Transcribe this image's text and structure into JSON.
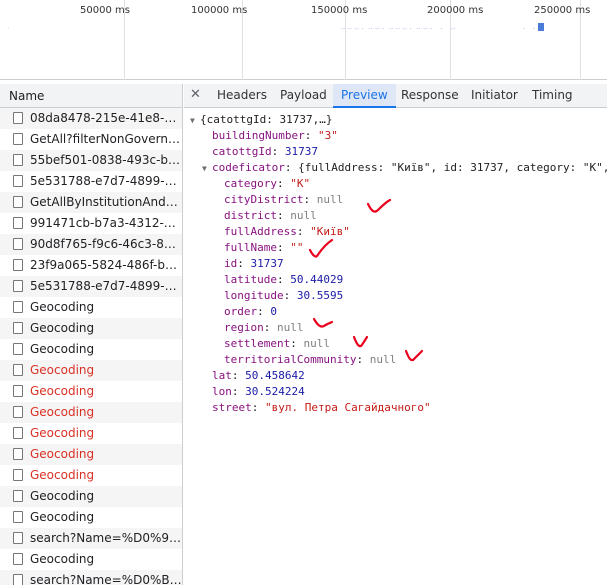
{
  "timeline": {
    "ticks": [
      "50000 ms",
      "100000 ms",
      "150000 ms",
      "200000 ms",
      "250000 ms"
    ]
  },
  "name_column": {
    "header": "Name",
    "rows": [
      {
        "text": "08da8478-215e-41e8-881...",
        "error": false,
        "icon": "document-icon"
      },
      {
        "text": "GetAll?filterNonGovernm...",
        "error": false,
        "icon": "document-icon"
      },
      {
        "text": "55bef501-0838-493c-b5f...",
        "error": false,
        "icon": "document-icon"
      },
      {
        "text": "5e531788-e7d7-4899-80c...",
        "error": false,
        "icon": "document-icon"
      },
      {
        "text": "GetAllByInstitutionAndLev...",
        "error": false,
        "icon": "document-icon"
      },
      {
        "text": "991471cb-b7a3-4312-bb...",
        "error": false,
        "icon": "document-icon"
      },
      {
        "text": "90d8f765-f9c6-46c3-8b24...",
        "error": false,
        "icon": "document-icon"
      },
      {
        "text": "23f9a065-5824-486f-bae3...",
        "error": false,
        "icon": "document-icon"
      },
      {
        "text": "5e531788-e7d7-4899-80c...",
        "error": false,
        "icon": "document-icon"
      },
      {
        "text": "Geocoding",
        "error": false,
        "icon": "document-icon"
      },
      {
        "text": "Geocoding",
        "error": false,
        "icon": "document-icon"
      },
      {
        "text": "Geocoding",
        "error": false,
        "icon": "document-icon"
      },
      {
        "text": "Geocoding",
        "error": true,
        "icon": "document-icon"
      },
      {
        "text": "Geocoding",
        "error": true,
        "icon": "document-icon"
      },
      {
        "text": "Geocoding",
        "error": true,
        "icon": "document-icon"
      },
      {
        "text": "Geocoding",
        "error": true,
        "icon": "document-icon"
      },
      {
        "text": "Geocoding",
        "error": true,
        "icon": "document-icon"
      },
      {
        "text": "Geocoding",
        "error": true,
        "icon": "document-icon"
      },
      {
        "text": "Geocoding",
        "error": false,
        "icon": "document-icon"
      },
      {
        "text": "Geocoding",
        "error": false,
        "icon": "document-icon"
      },
      {
        "text": "search?Name=%D0%9B%...",
        "error": false,
        "icon": "document-icon"
      },
      {
        "text": "Geocoding",
        "error": false,
        "icon": "document-icon"
      },
      {
        "text": "search?Name=%D0%BA...",
        "error": false,
        "icon": "document-icon"
      }
    ]
  },
  "detail": {
    "close_icon": "close-icon",
    "tabs": [
      "Headers",
      "Payload",
      "Preview",
      "Response",
      "Initiator",
      "Timing"
    ],
    "active_tab": "Preview"
  },
  "preview": {
    "lines": [
      {
        "indent": 0,
        "toggle": "down",
        "parts": [
          {
            "c": "plain",
            "t": "{catottgId: 31737,…}"
          }
        ]
      },
      {
        "indent": 1,
        "parts": [
          {
            "c": "key",
            "t": "buildingNumber"
          },
          {
            "c": "plain",
            "t": ": "
          },
          {
            "c": "str",
            "t": "\"3\""
          }
        ]
      },
      {
        "indent": 1,
        "parts": [
          {
            "c": "key",
            "t": "catottgId"
          },
          {
            "c": "plain",
            "t": ": "
          },
          {
            "c": "num",
            "t": "31737"
          }
        ]
      },
      {
        "indent": 1,
        "toggle": "down",
        "parts": [
          {
            "c": "key",
            "t": "codeficator"
          },
          {
            "c": "plain",
            "t": ": {fullAddress: \"Київ\", id: 31737, category: \"K\","
          }
        ]
      },
      {
        "indent": 2,
        "parts": [
          {
            "c": "key",
            "t": "category"
          },
          {
            "c": "plain",
            "t": ": "
          },
          {
            "c": "str",
            "t": "\"K\""
          }
        ]
      },
      {
        "indent": 2,
        "parts": [
          {
            "c": "key",
            "t": "cityDistrict"
          },
          {
            "c": "plain",
            "t": ": "
          },
          {
            "c": "nul",
            "t": "null"
          }
        ]
      },
      {
        "indent": 2,
        "parts": [
          {
            "c": "key",
            "t": "district"
          },
          {
            "c": "plain",
            "t": ": "
          },
          {
            "c": "nul",
            "t": "null"
          }
        ]
      },
      {
        "indent": 2,
        "parts": [
          {
            "c": "key",
            "t": "fullAddress"
          },
          {
            "c": "plain",
            "t": ": "
          },
          {
            "c": "str",
            "t": "\"Київ\""
          }
        ]
      },
      {
        "indent": 2,
        "parts": [
          {
            "c": "key",
            "t": "fullName"
          },
          {
            "c": "plain",
            "t": ": "
          },
          {
            "c": "str",
            "t": "\"\""
          }
        ]
      },
      {
        "indent": 2,
        "parts": [
          {
            "c": "key",
            "t": "id"
          },
          {
            "c": "plain",
            "t": ": "
          },
          {
            "c": "num",
            "t": "31737"
          }
        ]
      },
      {
        "indent": 2,
        "parts": [
          {
            "c": "key",
            "t": "latitude"
          },
          {
            "c": "plain",
            "t": ": "
          },
          {
            "c": "num",
            "t": "50.44029"
          }
        ]
      },
      {
        "indent": 2,
        "parts": [
          {
            "c": "key",
            "t": "longitude"
          },
          {
            "c": "plain",
            "t": ": "
          },
          {
            "c": "num",
            "t": "30.5595"
          }
        ]
      },
      {
        "indent": 2,
        "parts": [
          {
            "c": "key",
            "t": "order"
          },
          {
            "c": "plain",
            "t": ": "
          },
          {
            "c": "num",
            "t": "0"
          }
        ]
      },
      {
        "indent": 2,
        "parts": [
          {
            "c": "key",
            "t": "region"
          },
          {
            "c": "plain",
            "t": ": "
          },
          {
            "c": "nul",
            "t": "null"
          }
        ]
      },
      {
        "indent": 2,
        "parts": [
          {
            "c": "key",
            "t": "settlement"
          },
          {
            "c": "plain",
            "t": ": "
          },
          {
            "c": "nul",
            "t": "null"
          }
        ]
      },
      {
        "indent": 2,
        "parts": [
          {
            "c": "key",
            "t": "territorialCommunity"
          },
          {
            "c": "plain",
            "t": ": "
          },
          {
            "c": "nul",
            "t": "null"
          }
        ]
      },
      {
        "indent": 1,
        "parts": [
          {
            "c": "key",
            "t": "lat"
          },
          {
            "c": "plain",
            "t": ": "
          },
          {
            "c": "num",
            "t": "50.458642"
          }
        ]
      },
      {
        "indent": 1,
        "parts": [
          {
            "c": "key",
            "t": "lon"
          },
          {
            "c": "plain",
            "t": ": "
          },
          {
            "c": "num",
            "t": "30.524224"
          }
        ]
      },
      {
        "indent": 1,
        "parts": [
          {
            "c": "key",
            "t": "street"
          },
          {
            "c": "plain",
            "t": ": "
          },
          {
            "c": "str",
            "t": "\"вул. Петра Сагайдачного\""
          }
        ]
      }
    ]
  },
  "colors": {
    "key": "#881280",
    "string": "#c41a16",
    "number": "#1a1aa6",
    "null": "#808080",
    "error_text": "#d93025",
    "active_tab": "#1a73e8",
    "annotation": "#e8001c"
  }
}
